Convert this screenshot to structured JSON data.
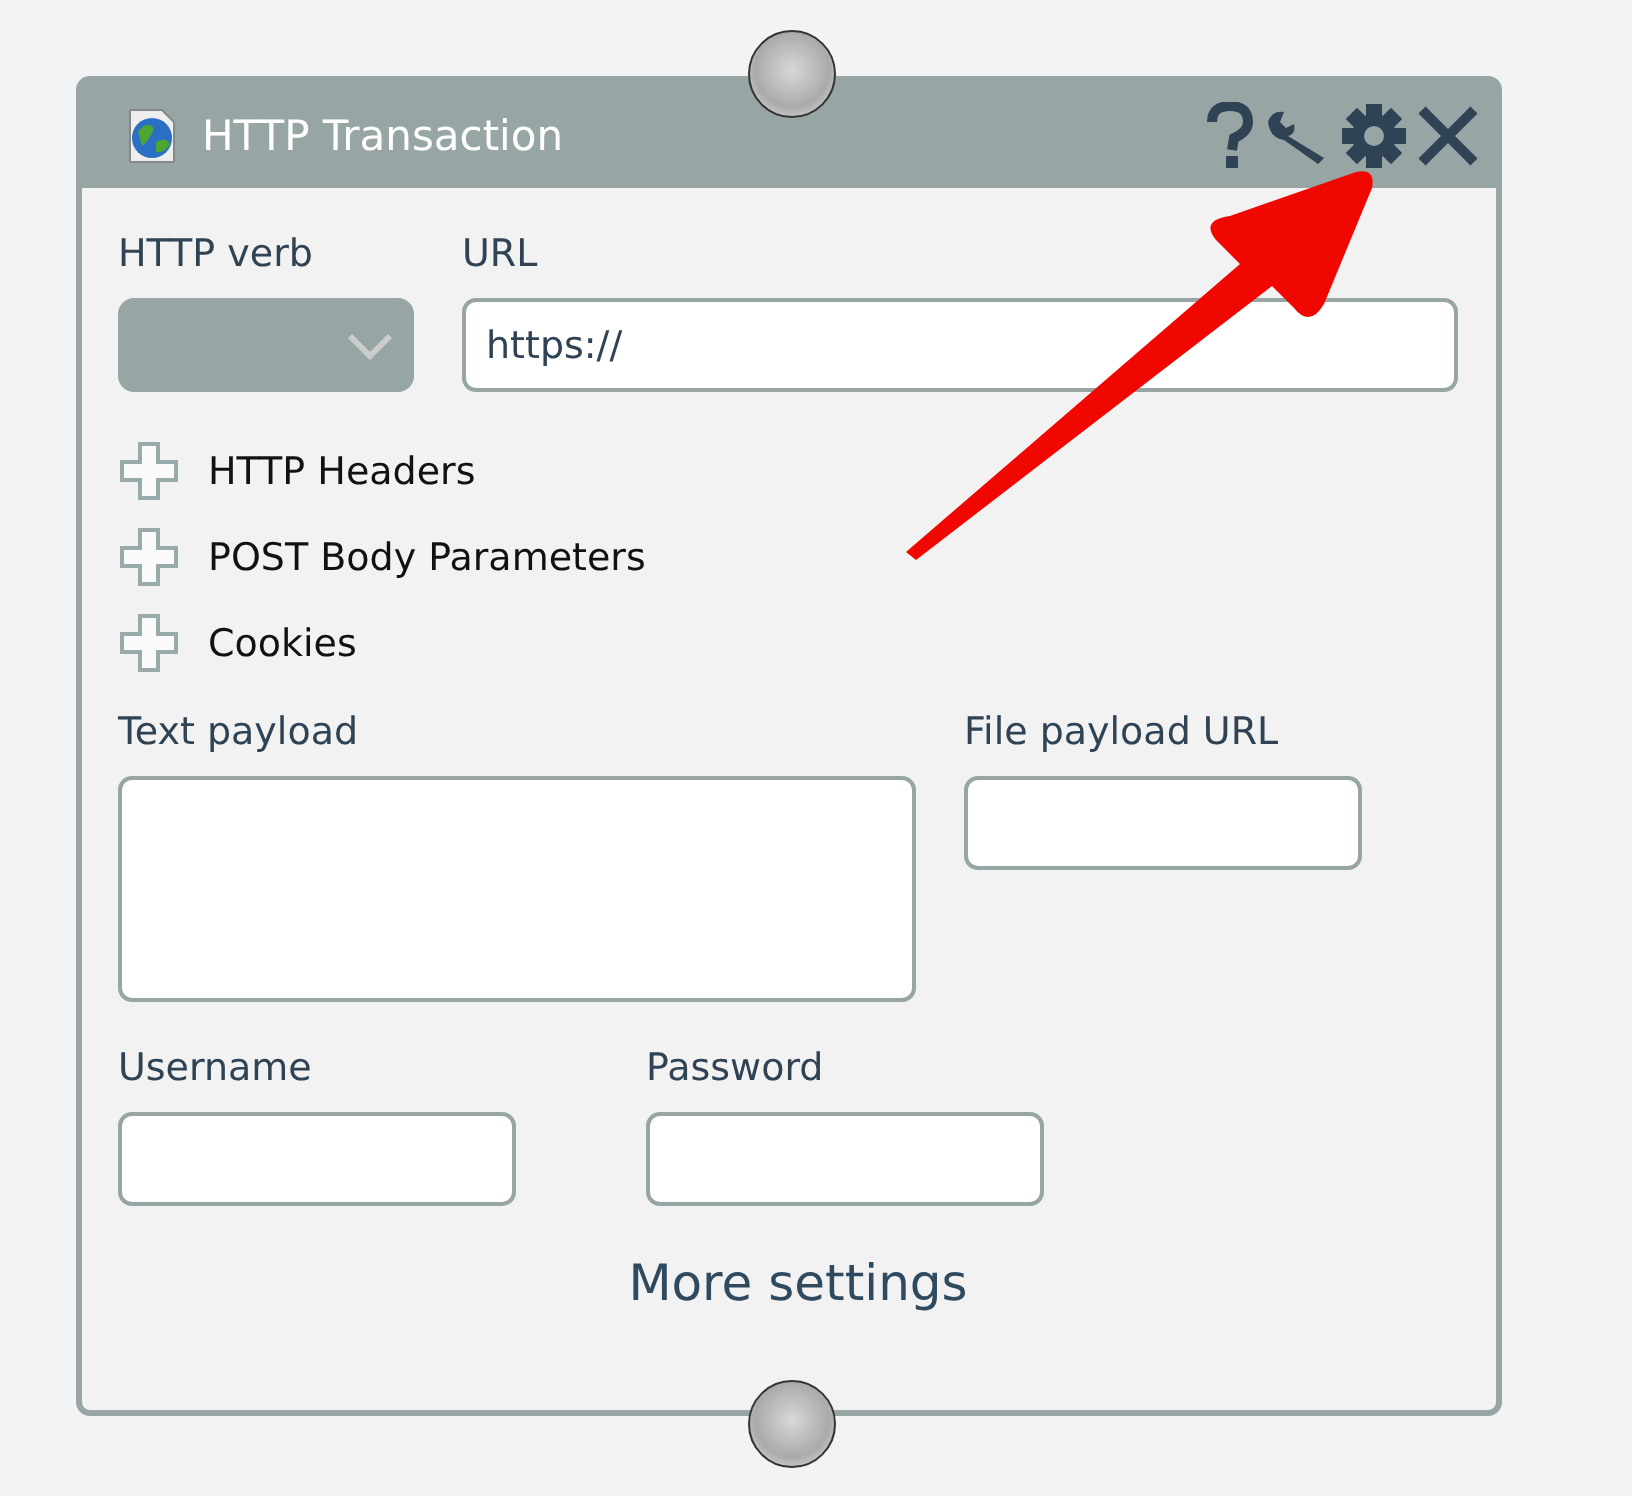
{
  "window": {
    "title": "HTTP Transaction"
  },
  "header_buttons": [
    {
      "kind": "help"
    },
    {
      "kind": "wrench"
    },
    {
      "kind": "settings"
    },
    {
      "kind": "close"
    }
  ],
  "http_verb": {
    "label": "HTTP verb"
  },
  "url": {
    "label": "URL",
    "value": "https://"
  },
  "sections": [
    {
      "label": "HTTP Headers",
      "expanded": false
    },
    {
      "label": "POST Body Parameters",
      "expanded": false
    },
    {
      "label": "Cookies",
      "expanded": false
    }
  ],
  "text_payload": {
    "label": "Text payload"
  },
  "file_payload_url": {
    "label": "File payload URL"
  },
  "username": {
    "label": "Username"
  },
  "password": {
    "label": "Password"
  },
  "more_settings": {
    "label": "More settings"
  }
}
